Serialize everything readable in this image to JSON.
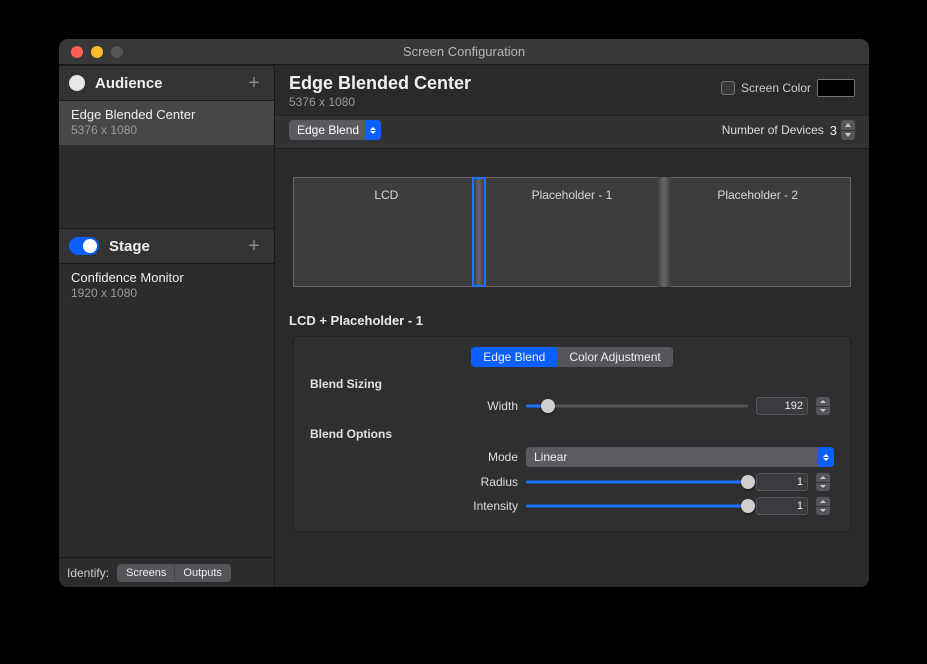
{
  "window": {
    "title": "Screen Configuration"
  },
  "sidebar": {
    "sections": [
      {
        "title": "Audience",
        "toggleStyle": "off-indicator",
        "items": [
          {
            "name": "Edge Blended Center",
            "resolution": "5376 x 1080",
            "selected": true
          }
        ]
      },
      {
        "title": "Stage",
        "toggleStyle": "on",
        "items": [
          {
            "name": "Confidence Monitor",
            "resolution": "1920 x 1080",
            "selected": false
          }
        ]
      }
    ],
    "identify": {
      "label": "Identify:",
      "buttons": [
        "Screens",
        "Outputs"
      ]
    }
  },
  "main": {
    "title": "Edge Blended Center",
    "subtitle": "5376 x 1080",
    "screenColor": {
      "label": "Screen Color",
      "hex": "#000000"
    },
    "typeSelect": "Edge Blend",
    "numDevices": {
      "label": "Number of Devices",
      "value": 3
    },
    "preview": {
      "segments": [
        "LCD",
        "Placeholder - 1",
        "Placeholder - 2"
      ],
      "selectedBlendIndex": 0
    },
    "detail": {
      "title": "LCD + Placeholder - 1",
      "tabs": [
        "Edge Blend",
        "Color Adjustment"
      ],
      "activeTab": 0,
      "groups": {
        "sizingLabel": "Blend Sizing",
        "optionsLabel": "Blend Options"
      },
      "fields": {
        "widthLabel": "Width",
        "width": 192,
        "widthMax": 1792,
        "modeLabel": "Mode",
        "mode": "Linear",
        "radiusLabel": "Radius",
        "radius": 1,
        "intensityLabel": "Intensity",
        "intensity": 1
      }
    }
  }
}
